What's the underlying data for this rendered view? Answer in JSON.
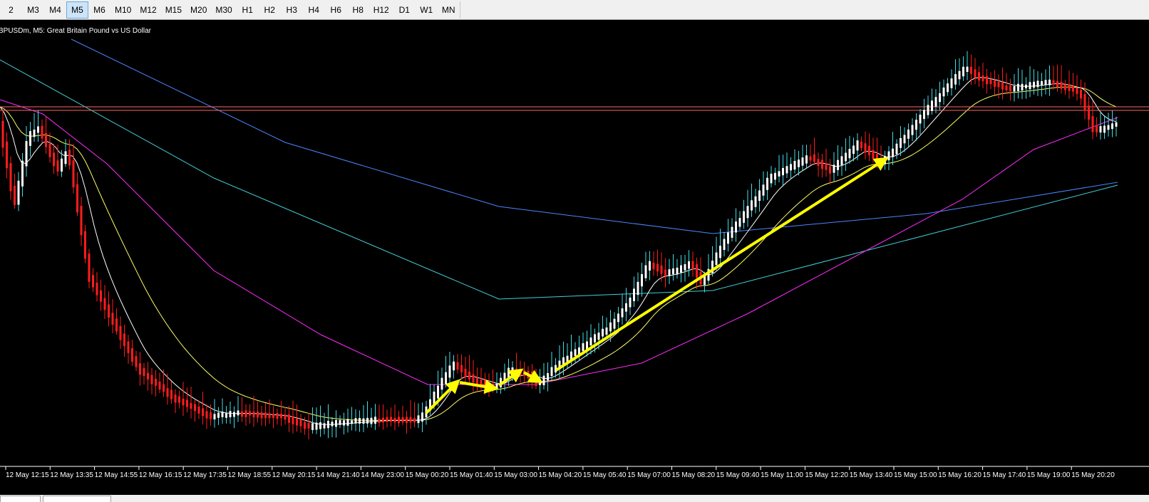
{
  "toolbar": {
    "timeframes": [
      "2",
      "M3",
      "M4",
      "M5",
      "M6",
      "M10",
      "M12",
      "M15",
      "M20",
      "M30",
      "H1",
      "H2",
      "H3",
      "H4",
      "H6",
      "H8",
      "H12",
      "D1",
      "W1",
      "MN"
    ],
    "active": "M5"
  },
  "chart": {
    "symbol_label": "BPUSDm, M5:  Great Britain Pound vs US Dollar",
    "time_labels": [
      "12 May 12:15",
      "12 May 13:35",
      "12 May 14:55",
      "12 May 16:15",
      "12 May 17:35",
      "12 May 18:55",
      "12 May 20:15",
      "14 May 21:40",
      "14 May 23:00",
      "15 May 00:20",
      "15 May 01:40",
      "15 May 03:00",
      "15 May 04:20",
      "15 May 05:40",
      "15 May 07:00",
      "15 May 08:20",
      "15 May 09:40",
      "15 May 11:00",
      "15 May 12:20",
      "15 May 13:40",
      "15 May 15:00",
      "15 May 16:20",
      "15 May 17:40",
      "15 May 19:00",
      "15 May 20:20"
    ]
  },
  "colors": {
    "bull": "#ffffff",
    "bear": "#ff1c1c",
    "up_wick": "#40e0e8",
    "ma_white": "#ffffff",
    "ma_yellow": "#ffff66",
    "ma_magenta": "#ff2cff",
    "ma_cyan": "#40d0d8",
    "ma_blue": "#4a86ff",
    "hline": "#ff6666",
    "arrow": "#ffff00"
  }
}
